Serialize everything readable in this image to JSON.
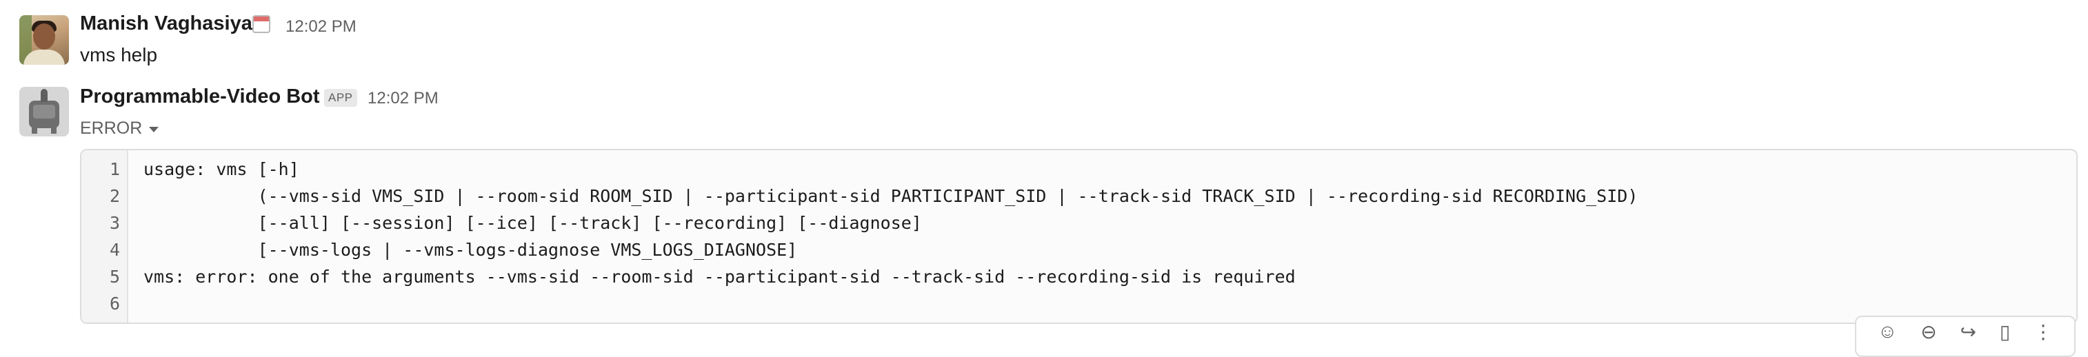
{
  "message_1": {
    "author": "Manish Vaghasiya",
    "status_emoji": "calendar-icon",
    "time": "12:02 PM",
    "text": "vms help"
  },
  "message_2": {
    "author": "Programmable-Video Bot",
    "badge": "APP",
    "time": "12:02 PM",
    "status": "ERROR",
    "code_lines": [
      {
        "no": "1",
        "text": "usage: vms [-h]"
      },
      {
        "no": "2",
        "text": "           (--vms-sid VMS_SID | --room-sid ROOM_SID | --participant-sid PARTICIPANT_SID | --track-sid TRACK_SID | --recording-sid RECORDING_SID)"
      },
      {
        "no": "3",
        "text": "           [--all] [--session] [--ice] [--track] [--recording] [--diagnose]"
      },
      {
        "no": "4",
        "text": "           [--vms-logs | --vms-logs-diagnose VMS_LOGS_DIAGNOSE]"
      },
      {
        "no": "5",
        "text": "vms: error: one of the arguments --vms-sid --room-sid --participant-sid --track-sid --recording-sid is required"
      },
      {
        "no": "6",
        "text": ""
      }
    ]
  },
  "toolbar": [
    "emoji-reaction-icon",
    "reply-icon",
    "share-icon",
    "bookmark-icon",
    "more-icon"
  ]
}
